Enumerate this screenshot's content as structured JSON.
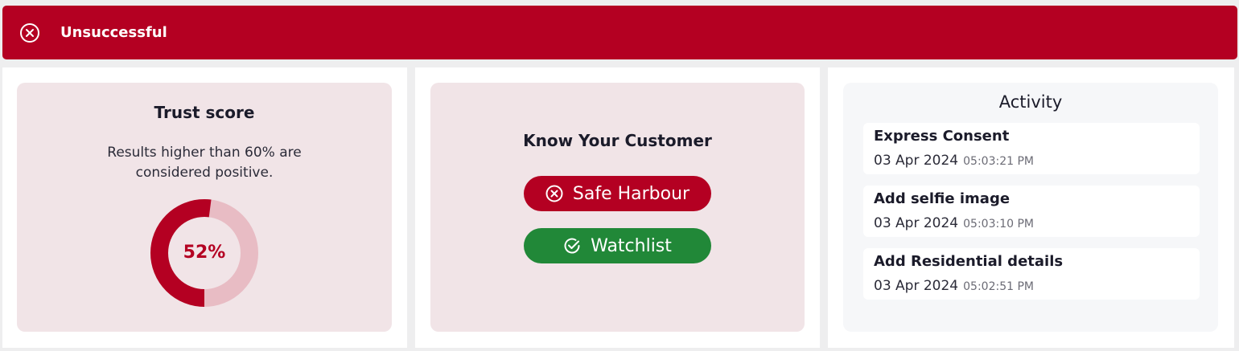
{
  "banner": {
    "status_text": "Unsuccessful",
    "icon": "close-circle-icon",
    "color": "#b40022"
  },
  "trust": {
    "title": "Trust score",
    "description_line1": "Results higher than 60% are",
    "description_line2": "considered positive.",
    "score_label": "52%",
    "score_fraction": 0.52,
    "fill_color": "#b40022",
    "track_color": "#e8bcc4"
  },
  "kyc": {
    "title": "Know Your Customer",
    "checks": [
      {
        "label": "Safe Harbour",
        "status": "failed",
        "icon": "close-circle-icon",
        "color": "#b40022"
      },
      {
        "label": "Watchlist",
        "status": "passed",
        "icon": "check-circle-icon",
        "color": "#218838"
      }
    ]
  },
  "activity": {
    "title": "Activity",
    "items": [
      {
        "name": "Express Consent",
        "date": "03 Apr 2024",
        "time": "05:03:21 PM"
      },
      {
        "name": "Add selfie image",
        "date": "03 Apr 2024",
        "time": "05:03:10 PM"
      },
      {
        "name": "Add Residential details",
        "date": "03 Apr 2024",
        "time": "05:02:51 PM"
      }
    ]
  }
}
